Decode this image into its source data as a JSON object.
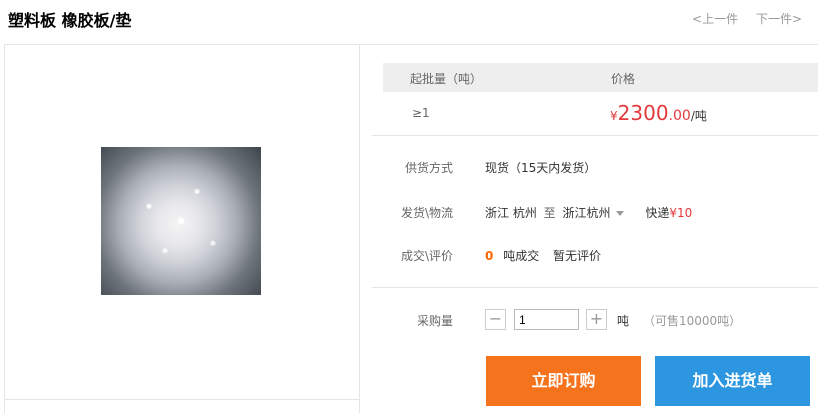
{
  "header": {
    "title": "塑料板 橡胶板/垫",
    "prev": "<上一件",
    "next": "下一件>"
  },
  "price_table": {
    "col_qty": "起批量（吨）",
    "col_price": "价格",
    "qty": "≥1",
    "currency": "¥",
    "price_int": "2300",
    "price_dec": ".00",
    "unit": "/吨"
  },
  "supply": {
    "label": "供货方式",
    "value": "现货（15天内发货）"
  },
  "shipping": {
    "label": "发货\\物流",
    "from": "浙江 杭州",
    "to_word": "至",
    "to": "浙江杭州",
    "express_label": "快递",
    "express_currency": "¥",
    "express_price": "10"
  },
  "deals": {
    "label": "成交\\评价",
    "count": "0",
    "count_suffix": "吨成交",
    "review": "暂无评价"
  },
  "purchase": {
    "label": "采购量",
    "minus": "−",
    "plus": "+",
    "quantity": "1",
    "unit": "吨",
    "available": "（可售10000吨）"
  },
  "buttons": {
    "buy": "立即订购",
    "add_cart": "加入进货单"
  },
  "colors": {
    "accent_red": "#e4393c",
    "buy_orange": "#f5731d",
    "cart_blue": "#2d96e0",
    "count_orange": "#ff6600"
  }
}
